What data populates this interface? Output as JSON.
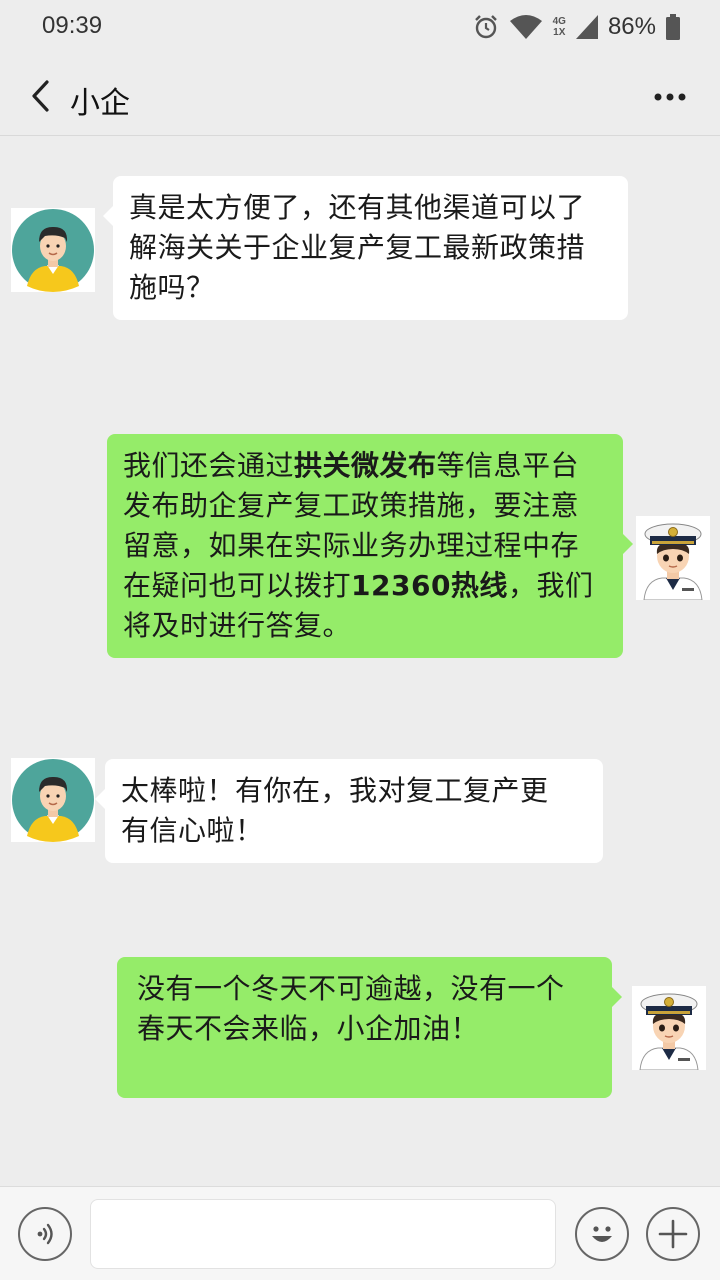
{
  "status_bar": {
    "time": "09:39",
    "network_top": "4G",
    "network_bottom": "1X",
    "battery": "86%"
  },
  "header": {
    "title": "小企"
  },
  "messages": [
    {
      "side": "left",
      "sender": "customer",
      "text": "真是太方便了，还有其他渠道可以了\n解海关关于企业复产复工最新政策措\n施吗？"
    },
    {
      "side": "right",
      "sender": "customs",
      "parts": [
        "我们还会通过",
        "拱关微发布",
        "等信息平台\n发布助企复产复工政策措施，要注意\n留意，如果在实际业务办理过程中存\n在疑问也可以拨打",
        "12360热线",
        "，我们\n将及时进行答复。"
      ]
    },
    {
      "side": "left",
      "sender": "customer",
      "text": "太棒啦！有你在，我对复工复产更\n有信心啦！"
    },
    {
      "side": "right",
      "sender": "customs",
      "text": "没有一个冬天不可逾越，没有一个\n春天不会来临，小企加油！"
    }
  ],
  "icons": {
    "back": "chevron-left-icon",
    "more": "more-dots-icon",
    "voice": "voice-icon",
    "emoji": "emoji-icon",
    "plus": "plus-icon",
    "alarm": "alarm-icon",
    "wifi": "wifi-icon",
    "signal": "signal-icon",
    "battery": "battery-icon"
  },
  "colors": {
    "background": "#ededed",
    "my_bubble": "#95ec69",
    "their_bubble": "#ffffff"
  }
}
